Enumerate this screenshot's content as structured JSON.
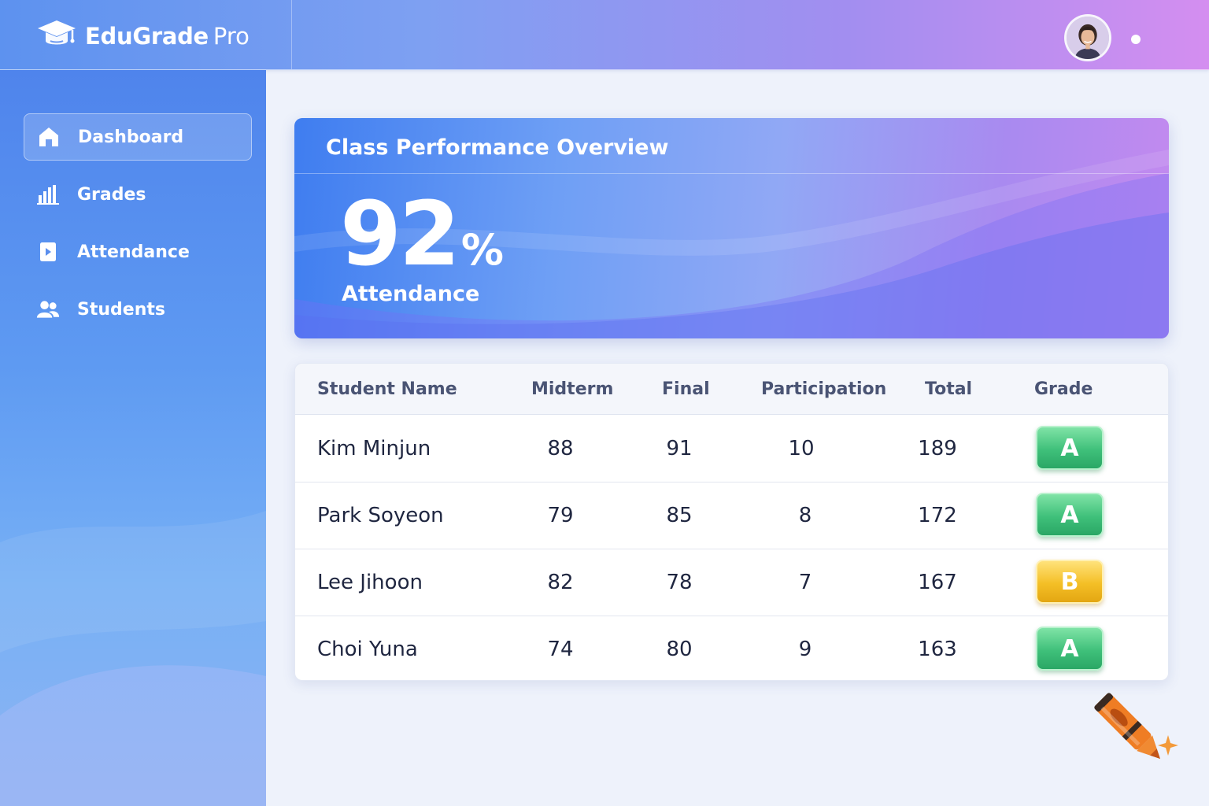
{
  "app": {
    "name": "EduGrade",
    "name_suffix": "Pro"
  },
  "icons": {
    "logo": "graduation-cap-icon",
    "avatar": "user-avatar",
    "decoration": "crayon-icon"
  },
  "colors": {
    "accent_blue": "#4f84ec",
    "accent_purple": "#c38aef",
    "grade_a": "#3fc07a",
    "grade_b": "#f4bf26"
  },
  "sidebar": {
    "items": [
      {
        "label": "Dashboard",
        "icon": "home-icon",
        "active": true
      },
      {
        "label": "Grades",
        "icon": "bar-chart-icon",
        "active": false
      },
      {
        "label": "Attendance",
        "icon": "calendar-play-icon",
        "active": false
      },
      {
        "label": "Students",
        "icon": "users-icon",
        "active": false
      }
    ]
  },
  "overview": {
    "title": "Class Performance Overview",
    "value": "92",
    "unit": "%",
    "label": "Attendance"
  },
  "table": {
    "columns": [
      "Student Name",
      "Midterm",
      "Final",
      "Participation",
      "Total",
      "Grade"
    ],
    "rows": [
      {
        "name": "Kim Minjun",
        "midterm": "88",
        "final": "91",
        "participation": "10",
        "total": "189",
        "grade": "A"
      },
      {
        "name": "Park Soyeon",
        "midterm": "79",
        "final": "85",
        "participation": "8",
        "total": "172",
        "grade": "A"
      },
      {
        "name": "Lee Jihoon",
        "midterm": "82",
        "final": "78",
        "participation": "7",
        "total": "167",
        "grade": "B"
      },
      {
        "name": "Choi Yuna",
        "midterm": "74",
        "final": "80",
        "participation": "9",
        "total": "163",
        "grade": "A"
      }
    ]
  }
}
